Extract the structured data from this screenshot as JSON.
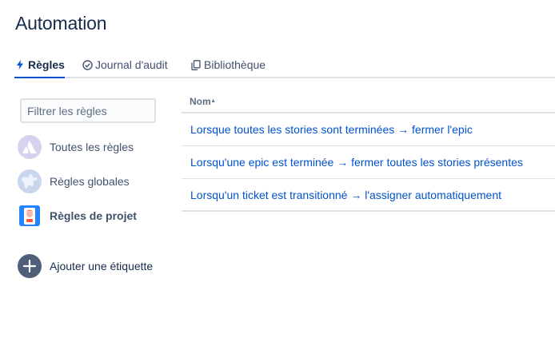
{
  "page": {
    "title": "Automation"
  },
  "tabs": [
    {
      "label": "Règles",
      "icon": "lightning-icon",
      "active": true
    },
    {
      "label": "Journal d'audit",
      "icon": "check-circle-icon",
      "active": false
    },
    {
      "label": "Bibliothèque",
      "icon": "copy-icon",
      "active": false
    }
  ],
  "sidebar": {
    "filter_placeholder": "Filtrer les règles",
    "items": [
      {
        "label": "Toutes les règles",
        "icon": "atlassian-logo-icon",
        "selected": false
      },
      {
        "label": "Règles globales",
        "icon": "globe-icon",
        "selected": false
      },
      {
        "label": "Règles de projet",
        "icon": "project-avatar-icon",
        "selected": true
      }
    ],
    "add_label": "Ajouter une étiquette"
  },
  "table": {
    "column_header": "Nom",
    "sort_glyph": "▴",
    "rows": [
      "Lorsque toutes les stories sont terminées → fermer l'epic",
      "Lorsqu'une epic est terminée → fermer toutes les stories présentes",
      "Lorsqu'un ticket est transitionné → l'assigner automatiquement"
    ]
  },
  "colors": {
    "link": "#0052cc",
    "text": "#172b4d",
    "muted": "#42526e",
    "border": "#dfe1e6"
  }
}
